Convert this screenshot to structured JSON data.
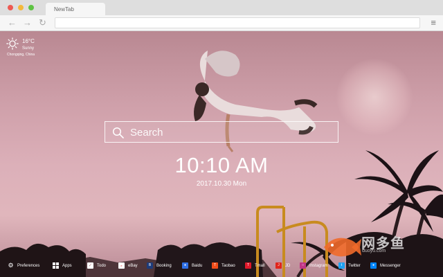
{
  "browser": {
    "tab_title": "NewTab",
    "url": ""
  },
  "weather": {
    "temperature": "16°C",
    "condition": "Sunny",
    "location": "Chongqing, China",
    "icon": "sun-icon"
  },
  "search": {
    "placeholder": "Search",
    "value": ""
  },
  "clock": {
    "time": "10:10 AM",
    "date": "2017.10.30 Mon"
  },
  "bottom_bar": {
    "preferences": "Preferences",
    "apps": "Apps",
    "todo": "Todo",
    "links": [
      {
        "label": "eBay",
        "icon": "ebay-icon",
        "color": "#ffffff"
      },
      {
        "label": "Booking",
        "icon": "booking-icon",
        "color": "#1d3b7a"
      },
      {
        "label": "Baidu",
        "icon": "baidu-icon",
        "color": "#2f6fe4"
      },
      {
        "label": "Taobao",
        "icon": "taobao-icon",
        "color": "#f04d1a"
      },
      {
        "label": "Tmall",
        "icon": "tmall-icon",
        "color": "#e0182a"
      },
      {
        "label": "JD",
        "icon": "jd-icon",
        "color": "#e1251b"
      },
      {
        "label": "Instagram",
        "icon": "instagram-icon",
        "color": "#c13584"
      },
      {
        "label": "Twitter",
        "icon": "twitter-icon",
        "color": "#1da1f2"
      },
      {
        "label": "Messenger",
        "icon": "messenger-icon",
        "color": "#0084ff"
      }
    ]
  },
  "watermark": {
    "text": "网多鱼",
    "subtext": "duoyu.com"
  }
}
